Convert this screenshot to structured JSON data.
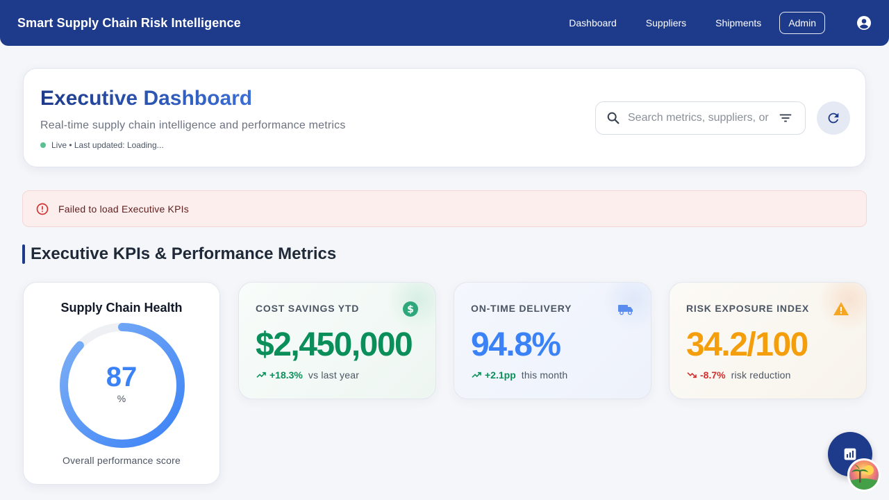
{
  "app": {
    "title": "Smart Supply Chain Risk Intelligence"
  },
  "nav": {
    "items": [
      "Dashboard",
      "Suppliers",
      "Shipments"
    ],
    "admin_label": "Admin",
    "account_icon": "account-circle-icon"
  },
  "header": {
    "title_part1": "Executive",
    "title_part2": "Dashboard",
    "subtitle": "Real-time supply chain intelligence and performance metrics",
    "status": "Live • Last updated: Loading...",
    "search_placeholder": "Search metrics, suppliers, or",
    "search_icon": "search-icon",
    "filter_icon": "filter-icon",
    "refresh_icon": "refresh-icon"
  },
  "alert": {
    "message": "Failed to load Executive KPIs",
    "icon": "error-outline-icon",
    "color": "#d32f2f"
  },
  "section": {
    "title": "Executive KPIs & Performance Metrics"
  },
  "health": {
    "title": "Supply Chain Health",
    "value": "87",
    "unit": "%",
    "fraction": 0.87,
    "caption": "Overall performance score"
  },
  "kpis": [
    {
      "label": "COST SAVINGS YTD",
      "value": "$2,450,000",
      "delta": "+18.3%",
      "note": "vs last year",
      "trend": "up",
      "color": "#0a8f5a",
      "icon": "dollar-icon"
    },
    {
      "label": "ON-TIME DELIVERY",
      "value": "94.8%",
      "delta": "+2.1pp",
      "note": "this month",
      "trend": "up",
      "color": "#3b82f6",
      "icon": "truck-icon"
    },
    {
      "label": "RISK EXPOSURE INDEX",
      "value": "34.2/100",
      "delta": "-8.7%",
      "note": "risk reduction",
      "trend": "down",
      "color": "#f59e0b",
      "icon": "warning-icon"
    }
  ],
  "colors": {
    "primary": "#1e3a8a",
    "success": "#0a8f5a",
    "danger": "#d32f2f",
    "warning": "#f59e0b",
    "info": "#3b82f6"
  }
}
